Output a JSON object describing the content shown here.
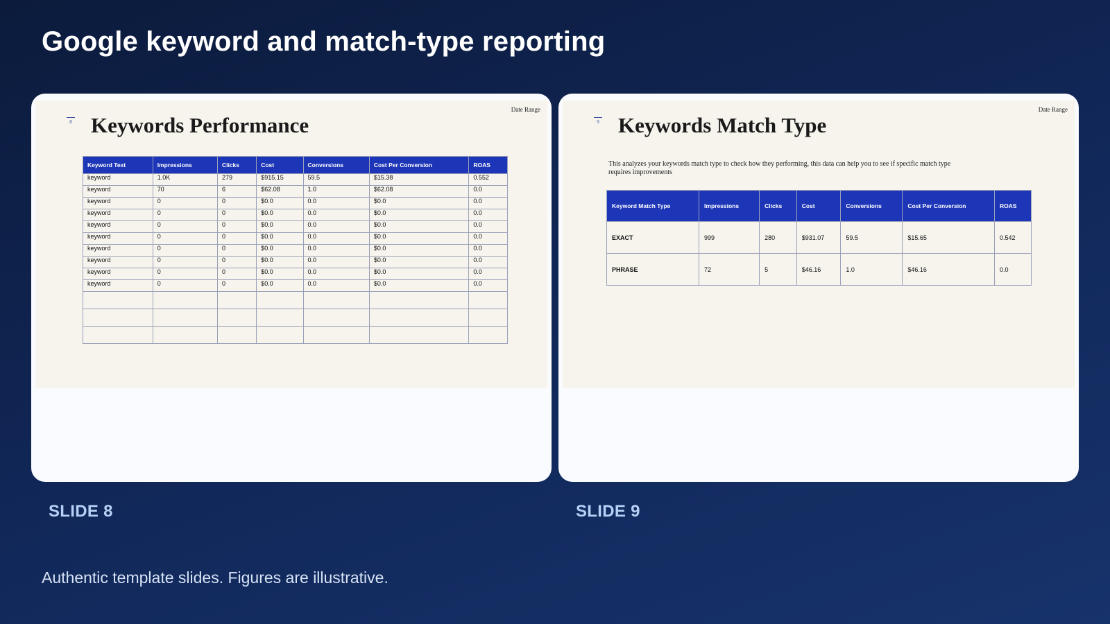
{
  "page": {
    "title": "Google keyword and match-type reporting",
    "footer": "Authentic template slides. Figures are illustrative."
  },
  "colors": {
    "table_header": "#1d36b8",
    "slide_bg": "#f6f4ed",
    "label": "#b7d0f5"
  },
  "slides": [
    {
      "label": "SLIDE 8",
      "number": "8",
      "date_range": "Date Range",
      "title": "Keywords Performance",
      "columns": [
        "Keyword Text",
        "Impressions",
        "Clicks",
        "Cost",
        "Conversions",
        "Cost Per Conversion",
        "ROAS"
      ],
      "rows": [
        [
          "keyword",
          "1.0K",
          "279",
          "$915.15",
          "59.5",
          "$15.38",
          "0.552"
        ],
        [
          "keyword",
          "70",
          "6",
          "$62.08",
          "1.0",
          "$62.08",
          "0.0"
        ],
        [
          "keyword",
          "0",
          "0",
          "$0.0",
          "0.0",
          "$0.0",
          "0.0"
        ],
        [
          "keyword",
          "0",
          "0",
          "$0.0",
          "0.0",
          "$0.0",
          "0.0"
        ],
        [
          "keyword",
          "0",
          "0",
          "$0.0",
          "0.0",
          "$0.0",
          "0.0"
        ],
        [
          "keyword",
          "0",
          "0",
          "$0.0",
          "0.0",
          "$0.0",
          "0.0"
        ],
        [
          "keyword",
          "0",
          "0",
          "$0.0",
          "0.0",
          "$0.0",
          "0.0"
        ],
        [
          "keyword",
          "0",
          "0",
          "$0.0",
          "0.0",
          "$0.0",
          "0.0"
        ],
        [
          "keyword",
          "0",
          "0",
          "$0.0",
          "0.0",
          "$0.0",
          "0.0"
        ],
        [
          "keyword",
          "0",
          "0",
          "$0.0",
          "0.0",
          "$0.0",
          "0.0"
        ]
      ],
      "empty_rows": 3
    },
    {
      "label": "SLIDE 9",
      "number": "9",
      "date_range": "Date Range",
      "title": "Keywords Match Type",
      "description": "This analyzes your keywords match type to check how they performing, this data can help you to see if specific match type requires improvements",
      "columns": [
        "Keyword Match Type",
        "Impressions",
        "Clicks",
        "Cost",
        "Conversions",
        "Cost Per Conversion",
        "ROAS"
      ],
      "rows": [
        [
          "EXACT",
          "999",
          "280",
          "$931.07",
          "59.5",
          "$15.65",
          "0.542"
        ],
        [
          "PHRASE",
          "72",
          "5",
          "$46.16",
          "1.0",
          "$46.16",
          "0.0"
        ]
      ]
    }
  ]
}
